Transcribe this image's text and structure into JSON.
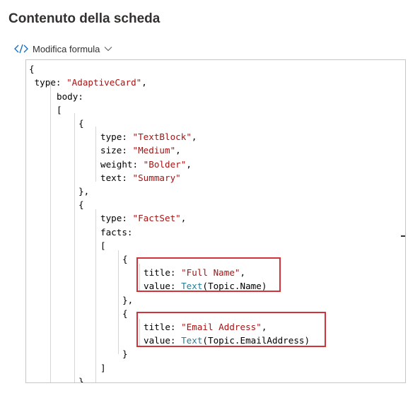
{
  "header": {
    "title": "Contenuto della scheda"
  },
  "formula_toggle": {
    "label": "Modifica formula",
    "icon": "code-icon"
  },
  "editor": {
    "lines": [
      {
        "text": "{"
      },
      {
        "text": " type: \"AdaptiveCard\","
      },
      {
        "text": "    body:"
      },
      {
        "text": "    ["
      },
      {
        "text": "        {"
      },
      {
        "text": "            type: \"TextBlock\","
      },
      {
        "text": "            size: \"Medium\","
      },
      {
        "text": "            weight: \"Bolder\","
      },
      {
        "text": "            text: \"Summary\""
      },
      {
        "text": "        },"
      },
      {
        "text": "        {"
      },
      {
        "text": "            type: \"FactSet\","
      },
      {
        "text": "            facts:"
      },
      {
        "text": "            ["
      },
      {
        "text": "                {"
      },
      {
        "text": "                    title: \"Full Name\","
      },
      {
        "text": "                    value: Text(Topic.Name)"
      },
      {
        "text": "                },"
      },
      {
        "text": "                {"
      },
      {
        "text": "                    title: \"Email Address\","
      },
      {
        "text": "                    value: Text(Topic.EmailAddress)"
      },
      {
        "text": "                }"
      },
      {
        "text": "            ]"
      },
      {
        "text": "        },"
      }
    ]
  },
  "colors": {
    "highlight_border": "#d13438",
    "string": "#a31515",
    "function": "#267f99"
  }
}
